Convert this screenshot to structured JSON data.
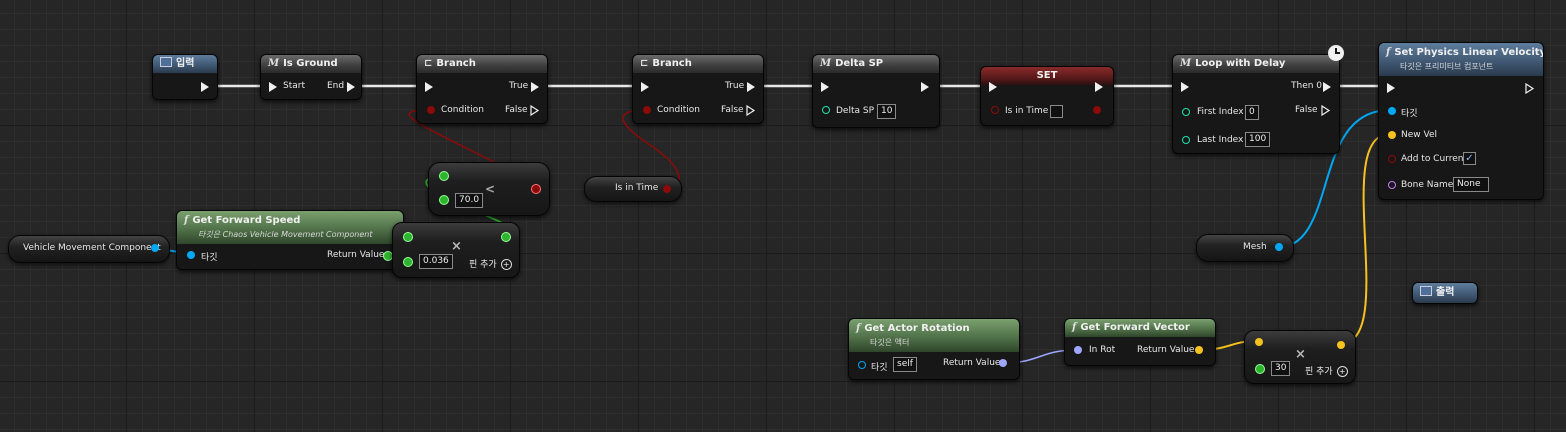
{
  "colors": {
    "exec": "#f0f0f0",
    "bool": "#8c0a0a",
    "float": "#7fd35b",
    "object": "#00a8f4",
    "struct": "#f7c21e",
    "rotator": "#9ea6ff",
    "int": "#1ee3b1",
    "name": "#c57cff"
  },
  "nodes": {
    "input": {
      "title": "입력"
    },
    "is_ground": {
      "title": "Is Ground",
      "start": "Start",
      "end": "End"
    },
    "branch1": {
      "title": "Branch",
      "true": "True",
      "condition": "Condition",
      "false": "False"
    },
    "branch2": {
      "title": "Branch",
      "true": "True",
      "condition": "Condition",
      "false": "False"
    },
    "delta_sp": {
      "title": "Delta SP",
      "pin": "Delta SP",
      "value": "10"
    },
    "set": {
      "title": "SET",
      "pin": "Is in Time"
    },
    "loop": {
      "title": "Loop with Delay",
      "then0": "Then 0",
      "false": "False",
      "first_index": "First Index",
      "first_value": "0",
      "last_index": "Last Index",
      "last_value": "100"
    },
    "set_velocity": {
      "title": "Set Physics Linear Velocity",
      "subtitle": "타깃은 프리미티브 컴포넌트",
      "target": "타깃",
      "new_vel": "New Vel",
      "add_to_current": "Add to Current",
      "bone_name": "Bone Name",
      "bone_value": "None"
    },
    "less": {
      "symbol": "<",
      "value": "70.0"
    },
    "is_in_time_var": {
      "label": "Is in Time"
    },
    "vmc_var": {
      "label": "Vehicle Movement Component"
    },
    "forward_speed": {
      "title": "Get Forward Speed",
      "subtitle": "타깃은 Chaos Vehicle Movement Component",
      "target": "타깃",
      "return": "Return Value"
    },
    "multiply1": {
      "value": "0.036",
      "add_pin": "핀 추가"
    },
    "mesh_var": {
      "label": "Mesh"
    },
    "output": {
      "title": "출력"
    },
    "actor_rotation": {
      "title": "Get Actor Rotation",
      "subtitle": "타깃은 액터",
      "target": "타깃",
      "target_value": "self",
      "return": "Return Value"
    },
    "forward_vector": {
      "title": "Get Forward Vector",
      "in_rot": "In Rot",
      "return": "Return Value"
    },
    "multiply2": {
      "value": "30",
      "add_pin": "핀 추가"
    }
  }
}
